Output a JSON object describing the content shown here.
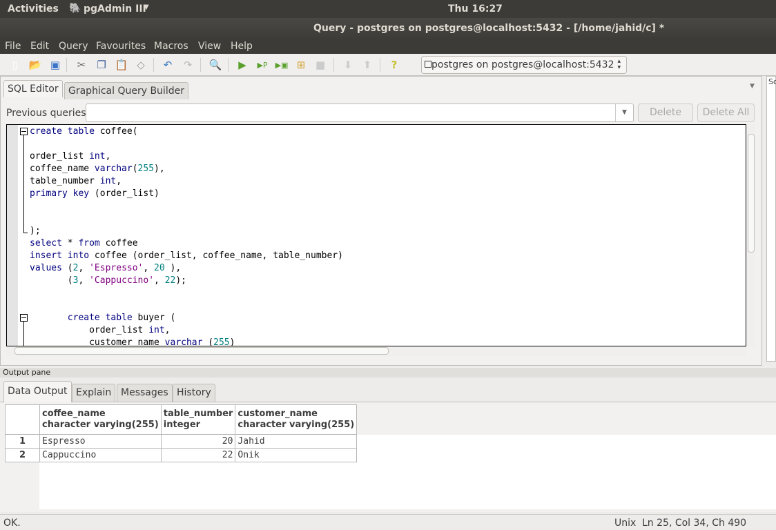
{
  "topbar": {
    "activities": "Activities",
    "app": "pgAdmin III",
    "clock": "Thu 16:27"
  },
  "window": {
    "title": "Query - postgres on postgres@localhost:5432 - [/home/jahid/c] *"
  },
  "menu": [
    "File",
    "Edit",
    "Query",
    "Favourites",
    "Macros",
    "View",
    "Help"
  ],
  "toolbar": {
    "icons": [
      "new-file-icon",
      "open-folder-icon",
      "save-icon",
      "cut-icon",
      "copy-icon",
      "paste-icon",
      "clear-icon",
      "undo-icon",
      "redo-icon",
      "find-icon",
      "execute-icon",
      "execute-pgscript-icon",
      "execute-to-file-icon",
      "explain-icon",
      "cancel-icon",
      "commit-icon",
      "rollback-icon",
      "help-icon"
    ],
    "connection": "postgres on postgres@localhost:5432"
  },
  "editor_tabs": [
    "SQL Editor",
    "Graphical Query Builder"
  ],
  "previous_queries": {
    "label": "Previous queries",
    "value": "",
    "delete": "Delete",
    "delete_all": "Delete All"
  },
  "side_panel": {
    "title": "Sc"
  },
  "code_lines": [
    [
      [
        "kw",
        "create table "
      ],
      [
        "",
        "coffee("
      ]
    ],
    [],
    [
      [
        "",
        "order_list "
      ],
      [
        "kw",
        "int"
      ],
      [
        "",
        ","
      ]
    ],
    [
      [
        "",
        "coffee_name "
      ],
      [
        "kw",
        "varchar"
      ],
      [
        "",
        "("
      ],
      [
        "num",
        "255"
      ],
      [
        "",
        "),"
      ]
    ],
    [
      [
        "",
        "table_number "
      ],
      [
        "kw",
        "int"
      ],
      [
        "",
        ","
      ]
    ],
    [
      [
        "kw",
        "primary key "
      ],
      [
        "",
        "(order_list)"
      ]
    ],
    [],
    [],
    [
      [
        "",
        ");"
      ]
    ],
    [
      [
        "kw",
        "select "
      ],
      [
        "",
        "* "
      ],
      [
        "kw",
        "from "
      ],
      [
        "",
        "coffee"
      ]
    ],
    [
      [
        "kw",
        "insert into "
      ],
      [
        "",
        "coffee (order_list, coffee_name, table_number)"
      ]
    ],
    [
      [
        "kw",
        "values "
      ],
      [
        "",
        "("
      ],
      [
        "num",
        "2"
      ],
      [
        "",
        ", "
      ],
      [
        "str",
        "'Espresso'"
      ],
      [
        "",
        ", "
      ],
      [
        "num",
        "20"
      ],
      [
        "",
        " ),"
      ]
    ],
    [
      [
        "",
        "       ("
      ],
      [
        "num",
        "3"
      ],
      [
        "",
        ", "
      ],
      [
        "str",
        "'Cappuccino'"
      ],
      [
        "",
        ", "
      ],
      [
        "num",
        "22"
      ],
      [
        "",
        ");"
      ]
    ],
    [],
    [],
    [
      [
        "",
        "       "
      ],
      [
        "kw",
        "create table "
      ],
      [
        "",
        "buyer ("
      ]
    ],
    [
      [
        "",
        "           order_list "
      ],
      [
        "kw",
        "int"
      ],
      [
        "",
        ","
      ]
    ],
    [
      [
        "",
        "           customer_name "
      ],
      [
        "kw",
        "varchar "
      ],
      [
        "",
        "("
      ],
      [
        "num",
        "255"
      ],
      [
        "",
        ")"
      ]
    ]
  ],
  "colors": {
    "keyword": "#00007f",
    "number": "#007f7f",
    "string": "#7f007f"
  },
  "output": {
    "pane_label": "Output pane",
    "tabs": [
      "Data Output",
      "Explain",
      "Messages",
      "History"
    ],
    "columns": [
      {
        "name": "coffee_name",
        "type": "character varying(255)"
      },
      {
        "name": "table_number",
        "type": "integer"
      },
      {
        "name": "customer_name",
        "type": "character varying(255)"
      }
    ],
    "rows": [
      {
        "n": "1",
        "cells": [
          "Espresso",
          "20",
          "Jahid"
        ]
      },
      {
        "n": "2",
        "cells": [
          "Cappuccino",
          "22",
          "Onik"
        ]
      }
    ]
  },
  "status": {
    "left": "OK.",
    "format": "Unix",
    "position": "Ln 25, Col 34, Ch 490"
  }
}
